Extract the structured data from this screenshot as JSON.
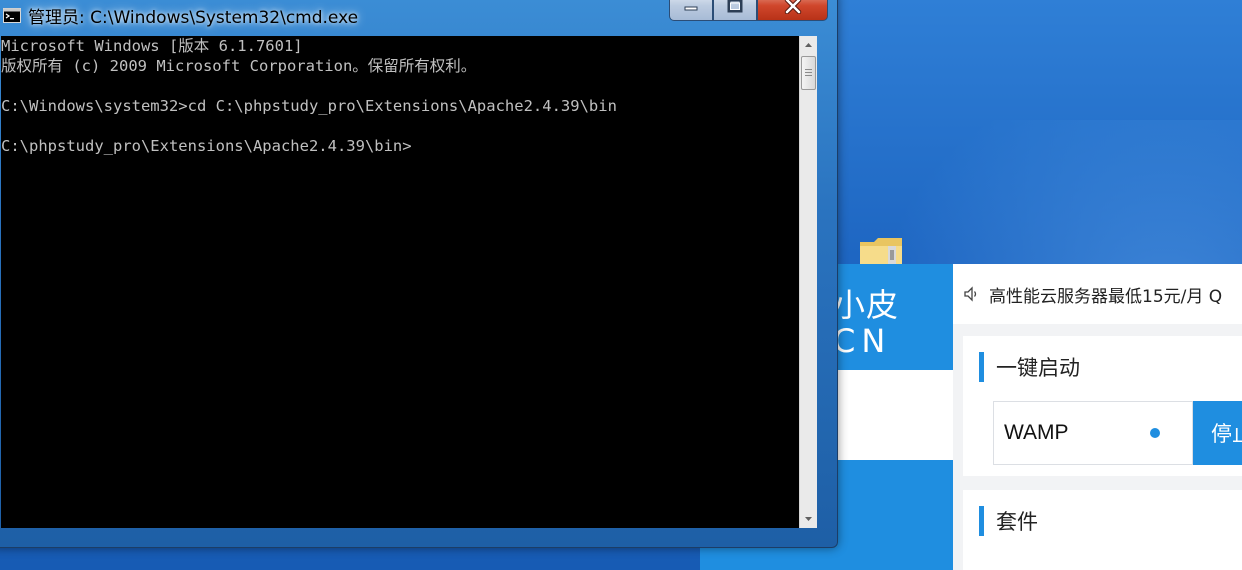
{
  "cmd": {
    "title": "管理员: C:\\Windows\\System32\\cmd.exe",
    "lines": [
      "Microsoft Windows [版本 6.1.7601]",
      "版权所有 (c) 2009 Microsoft Corporation。保留所有权利。",
      "",
      "C:\\Windows\\system32>cd C:\\phpstudy_pro\\Extensions\\Apache2.4.39\\bin",
      "",
      "C:\\phpstudy_pro\\Extensions\\Apache2.4.39\\bin>"
    ]
  },
  "app": {
    "logo_line1": "小皮",
    "logo_line2": "CN",
    "notice": "高性能云服务器最低15元/月  Q",
    "quick_start": {
      "title": "一键启动",
      "service": "WAMP",
      "action": "停止"
    },
    "suite_title": "套件"
  },
  "icons": {
    "title": "cmd-icon",
    "minimize": "minimize-icon",
    "maximize": "maximize-icon",
    "close": "close-icon",
    "notice": "speaker-icon",
    "desktop": "folder-icon"
  },
  "colors": {
    "app_accent": "#1f8ee0",
    "console_bg": "#000000",
    "console_text": "#c0c0c0"
  }
}
